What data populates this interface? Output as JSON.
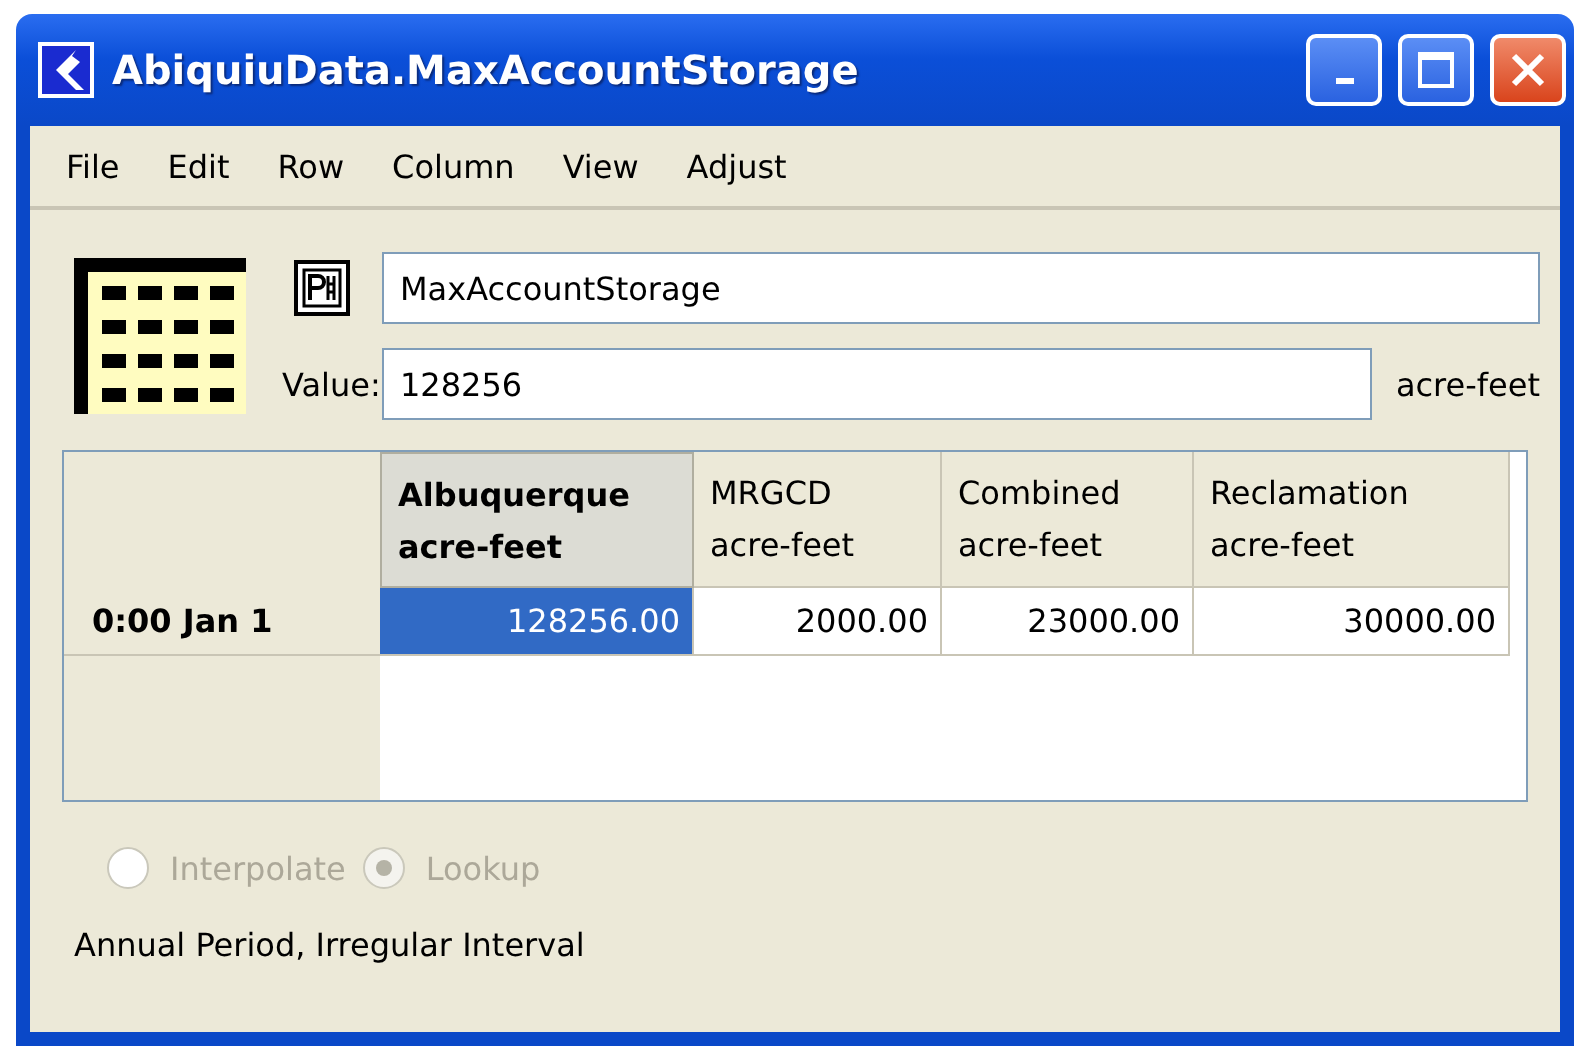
{
  "window": {
    "title": "AbiquiuData.MaxAccountStorage"
  },
  "menu": [
    "File",
    "Edit",
    "Row",
    "Column",
    "View",
    "Adjust"
  ],
  "name_field": {
    "value": "MaxAccountStorage"
  },
  "value_field": {
    "label": "Value:",
    "value": "128256",
    "units": "acre-feet"
  },
  "table": {
    "columns": [
      {
        "name": "Albuquerque",
        "units": "acre-feet",
        "selected": true
      },
      {
        "name": "MRGCD",
        "units": "acre-feet",
        "selected": false
      },
      {
        "name": "Combined",
        "units": "acre-feet",
        "selected": false
      },
      {
        "name": "Reclamation",
        "units": "acre-feet",
        "selected": false
      }
    ],
    "rows": [
      {
        "label": "0:00 Jan 1",
        "cells": [
          {
            "text": "128256.00",
            "selected": true
          },
          {
            "text": "2000.00",
            "selected": false
          },
          {
            "text": "23000.00",
            "selected": false
          },
          {
            "text": "30000.00",
            "selected": false
          }
        ]
      }
    ]
  },
  "mode": {
    "disabled": true,
    "options": [
      {
        "label": "Interpolate",
        "selected": false
      },
      {
        "label": "Lookup",
        "selected": true
      }
    ]
  },
  "status": "Annual Period, Irregular Interval"
}
